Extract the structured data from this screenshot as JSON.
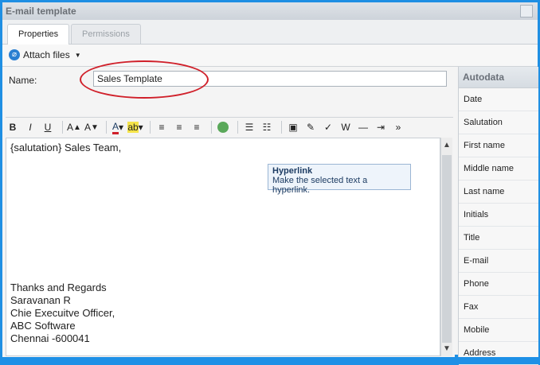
{
  "window": {
    "title": "E-mail template"
  },
  "tabs": [
    {
      "label": "Properties"
    },
    {
      "label": "Permissions"
    }
  ],
  "attach": {
    "label": "Attach files"
  },
  "name_field": {
    "label": "Name:",
    "value": "Sales Template"
  },
  "toolbar": {
    "buttons": [
      "bold-icon",
      "italic-icon",
      "underline-icon",
      "grow-font-icon",
      "shrink-font-icon",
      "font-color-icon",
      "highlight-icon",
      "align-left-icon",
      "align-center-icon",
      "align-right-icon",
      "hyperlink-icon",
      "numbered-list-icon",
      "bulleted-list-icon",
      "insert-image-icon",
      "paint-icon",
      "spellcheck-icon",
      "word-icon",
      "horizontal-rule-icon",
      "indent-icon",
      "more-icon"
    ]
  },
  "editor": {
    "lines": [
      "{salutation} Sales Team,",
      "Thanks and Regards",
      "Saravanan R",
      "Chie Execuitve Officer,",
      "ABC Software",
      "Chennai -600041"
    ]
  },
  "tooltip": {
    "title": "Hyperlink",
    "text": "Make the selected text a hyperlink."
  },
  "autodata": {
    "header": "Autodata",
    "items": [
      "Date",
      "Salutation",
      "First name",
      "Middle name",
      "Last name",
      "Initials",
      "Title",
      "E-mail",
      "Phone",
      "Fax",
      "Mobile",
      "Address"
    ]
  }
}
